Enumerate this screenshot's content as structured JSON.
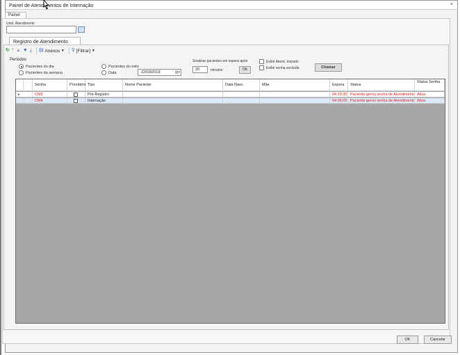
{
  "window": {
    "title": "Painel de Atendimentos de Internação",
    "close_icon": "×"
  },
  "tabs": {
    "painel": "Painel"
  },
  "unidade": {
    "label": "Unid. Atendimento",
    "value": ""
  },
  "subtab": {
    "label": "Registro de Atendimento"
  },
  "toolbar": {
    "anexos": "Anexos",
    "filtrar": "[Filtrar]"
  },
  "periodos": {
    "label": "Períodos",
    "options": [
      {
        "label": "Pacientes do dia",
        "selected": true
      },
      {
        "label": "Pacientes da semana",
        "selected": false
      },
      {
        "label": "Pacientes do mês",
        "selected": false
      },
      {
        "label": "Data",
        "selected": false
      }
    ],
    "date": "22/03/2019"
  },
  "sinalizar": {
    "label": "Sinalizar pacientes em espera após",
    "value": "20",
    "unit": "minutos",
    "ok": "Ok"
  },
  "checks": {
    "exibir_atend": "Exibir Atend. Iniciado",
    "exibir_senha": "Exibir senha excluída"
  },
  "chamar": "Chamar",
  "grid": {
    "columns": [
      "Senha",
      "Prioritário",
      "Tipo",
      "Nome Paciente",
      "Data Nasc.",
      "Mãe",
      "Espera",
      "Status",
      "Status Senha"
    ],
    "rows": [
      {
        "senha": "CM3",
        "prioritario": false,
        "tipo": "Pré-Registro",
        "nome": "",
        "nasc": "",
        "mae": "",
        "espera": "04:29:35",
        "status": "Paciente gerou senha de Atendimento",
        "status_senha": "Ativa"
      },
      {
        "senha": "CM4",
        "prioritario": false,
        "tipo": "Internação",
        "nome": "",
        "nasc": "",
        "mae": "",
        "espera": "04:05:05",
        "status": "Paciente gerou senha de Atendimento",
        "status_senha": "Ativa"
      }
    ]
  },
  "buttons": {
    "ok": "OK",
    "cancelar": "Cancelar"
  },
  "colors": {
    "alert_red": "#e02020",
    "selected_row": "#dce9f7",
    "grid_bg": "#a7a7a7"
  }
}
